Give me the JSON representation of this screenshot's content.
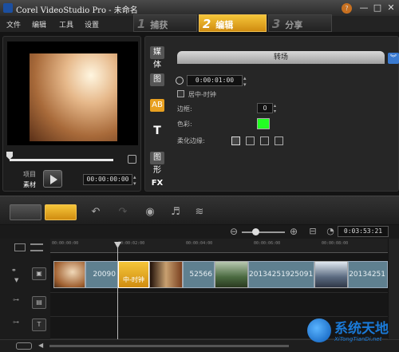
{
  "window": {
    "title": "Corel VideoStudio Pro - 未命名",
    "controls": [
      "—",
      "□",
      "✕"
    ]
  },
  "menu": [
    "文件",
    "编辑",
    "工具",
    "设置"
  ],
  "steps": [
    {
      "num": "1",
      "label": "捕获"
    },
    {
      "num": "2",
      "label": "编辑"
    },
    {
      "num": "3",
      "label": "分享"
    }
  ],
  "preview": {
    "mode_project": "项目",
    "mode_clip": "素材",
    "timecode": "00:00:00:00"
  },
  "options": {
    "tab_label": "转场",
    "duration": "0:00:01:00",
    "center_label": "居中-时钟",
    "border_label": "边框:",
    "border_value": "0",
    "color_label": "色彩:",
    "color_value": "#22ff22",
    "soft_edge_label": "柔化边缘:",
    "side_icons": [
      "媒体",
      "图",
      "AB",
      "T",
      "图形",
      "FX"
    ]
  },
  "timeline": {
    "timecode": "0:03:53:21",
    "ruler": [
      "00:00:00:00",
      "00:00:02:00",
      "00:00:04:00",
      "00:00:06:00",
      "00:00:08:00"
    ],
    "clips": [
      {
        "label": "",
        "kind": "thumb"
      },
      {
        "label": "20090",
        "kind": "clip"
      },
      {
        "label": "中-时钟",
        "kind": "transition"
      },
      {
        "label": "",
        "kind": "thumb"
      },
      {
        "label": "52566",
        "kind": "clip"
      },
      {
        "label": "",
        "kind": "thumb"
      },
      {
        "label": "20134251925091",
        "kind": "clip"
      },
      {
        "label": "",
        "kind": "thumb"
      },
      {
        "label": "20134251",
        "kind": "clip"
      }
    ]
  },
  "watermark": {
    "name": "系统天地",
    "url": "XiTongTianDi.net"
  }
}
